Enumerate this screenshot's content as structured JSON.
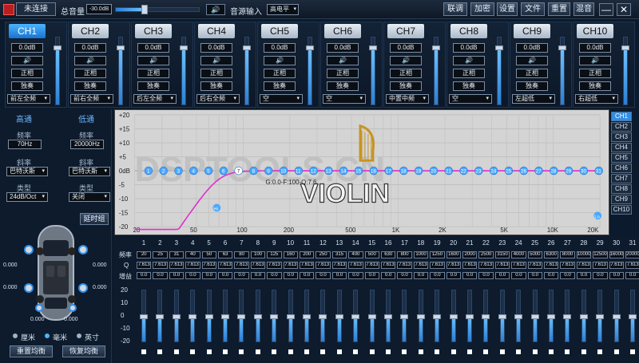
{
  "topbar": {
    "connect_status": "未连接",
    "master_volume_label": "总音量",
    "master_volume_value": "-30.0dB",
    "master_volume_level": 0.35,
    "input_label": "音源输入",
    "input_value": "高电平",
    "buttons": [
      "联调",
      "加密",
      "设置",
      "文件",
      "重置",
      "混音"
    ],
    "minimize": "—",
    "close": "✕"
  },
  "channels": [
    {
      "name": "CH1",
      "gain": "0.0dB",
      "phase": "正相",
      "solo": "独奏",
      "assign": "前左全频",
      "level": 0.85
    },
    {
      "name": "CH2",
      "gain": "0.0dB",
      "phase": "正相",
      "solo": "独奏",
      "assign": "前右全频",
      "level": 0.85
    },
    {
      "name": "CH3",
      "gain": "0.0dB",
      "phase": "正相",
      "solo": "独奏",
      "assign": "后左全频",
      "level": 0.85
    },
    {
      "name": "CH4",
      "gain": "0.0dB",
      "phase": "正相",
      "solo": "独奏",
      "assign": "后右全频",
      "level": 0.85
    },
    {
      "name": "CH5",
      "gain": "0.0dB",
      "phase": "正相",
      "solo": "独奏",
      "assign": "空",
      "level": 0.85
    },
    {
      "name": "CH6",
      "gain": "0.0dB",
      "phase": "正相",
      "solo": "独奏",
      "assign": "空",
      "level": 0.85
    },
    {
      "name": "CH7",
      "gain": "0.0dB",
      "phase": "正相",
      "solo": "独奏",
      "assign": "中置中频",
      "level": 0.85
    },
    {
      "name": "CH8",
      "gain": "0.0dB",
      "phase": "正相",
      "solo": "独奏",
      "assign": "空",
      "level": 0.85
    },
    {
      "name": "CH9",
      "gain": "0.0dB",
      "phase": "正相",
      "solo": "独奏",
      "assign": "左超低",
      "level": 0.85
    },
    {
      "name": "CH10",
      "gain": "0.0dB",
      "phase": "正相",
      "solo": "独奏",
      "assign": "右超低",
      "level": 0.85
    }
  ],
  "crossover": {
    "highpass_label": "高通",
    "lowpass_label": "低通",
    "freq_label": "频率",
    "slope_label": "斜率",
    "type_label": "类型",
    "hp_freq": "70Hz",
    "lp_freq": "20000Hz",
    "hp_slope": "巴特沃斯",
    "lp_slope": "巴特沃斯",
    "hp_type": "24dB/Oct",
    "lp_type": "关闭"
  },
  "delay": {
    "group_button": "延时组",
    "values": [
      "0.000",
      "0.000",
      "0.000",
      "0.000",
      "0.000",
      "0.000"
    ],
    "units": [
      "厘米",
      "毫米",
      "英寸"
    ],
    "selected_unit": "毫米",
    "reset_button": "重置均衡",
    "restore_button": "恢复均衡"
  },
  "graph": {
    "y_ticks": [
      "+20",
      "+15",
      "+10",
      "+5",
      "0dB",
      "-5",
      "-10",
      "-15",
      "-20"
    ],
    "x_ticks": [
      "20",
      "50",
      "100",
      "200",
      "500",
      "1K",
      "2K",
      "5K",
      "10K",
      "20K"
    ],
    "band_points": [
      "1",
      "2",
      "3",
      "4",
      "5",
      "6",
      "7",
      "8",
      "9",
      "10",
      "11",
      "12",
      "13",
      "14",
      "15",
      "16",
      "17",
      "18",
      "19",
      "20",
      "21",
      "22",
      "23",
      "24",
      "25",
      "26",
      "27",
      "28",
      "29",
      "30",
      "31"
    ],
    "hp_marker": "Hi",
    "lp_marker": "Lo",
    "info": "G:0.0-F:100-Q:7.6",
    "watermark_main": "VIOLIN",
    "watermark_bg": "DSPTOOLS.CN",
    "channel_list": [
      "CH1",
      "CH2",
      "CH3",
      "CH4",
      "CH5",
      "CH6",
      "CH7",
      "CH8",
      "CH9",
      "CH10"
    ],
    "selected_channel": "CH1"
  },
  "eq": {
    "row_labels": [
      "频率",
      "Q",
      "增益"
    ],
    "band_numbers": [
      "1",
      "2",
      "3",
      "4",
      "5",
      "6",
      "7",
      "8",
      "9",
      "10",
      "11",
      "12",
      "13",
      "14",
      "15",
      "16",
      "17",
      "18",
      "19",
      "20",
      "21",
      "22",
      "23",
      "24",
      "25",
      "26",
      "27",
      "28",
      "29",
      "30",
      "31"
    ],
    "freqs": [
      "20",
      "25",
      "31",
      "40",
      "50",
      "63",
      "80",
      "100",
      "125",
      "160",
      "200",
      "250",
      "315",
      "400",
      "500",
      "630",
      "800",
      "1000",
      "1250",
      "1600",
      "2000",
      "2500",
      "3150",
      "4000",
      "5000",
      "6300",
      "8000",
      "10000",
      "12500",
      "16000",
      "20000"
    ],
    "q_value": "7.613",
    "gain_value": "0.0",
    "slider_scale": [
      "20",
      "10",
      "0",
      "-10",
      "-20"
    ]
  }
}
